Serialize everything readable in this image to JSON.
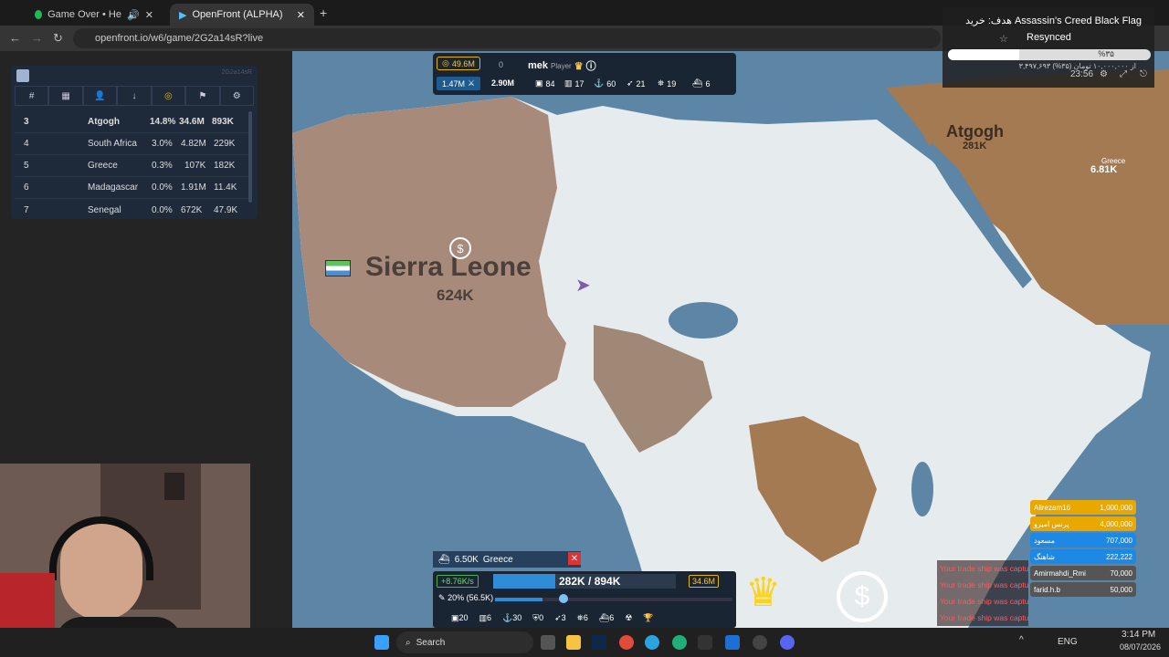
{
  "browser": {
    "tabs": [
      {
        "label": "Game Over • Helynt, Gameboy"
      },
      {
        "label": "OpenFront (ALPHA)"
      }
    ],
    "url": "openfront.io/w6/game/2G2a14sR?live",
    "new_tab": "+"
  },
  "leaderboard": {
    "game_id": "2G2a14sR",
    "rows": [
      {
        "rank": "3",
        "name": "Atgogh",
        "pct": "14.8%",
        "gold": "34.6M",
        "troops": "893K"
      },
      {
        "rank": "4",
        "name": "South Africa",
        "pct": "3.0%",
        "gold": "4.82M",
        "troops": "229K"
      },
      {
        "rank": "5",
        "name": "Greece",
        "pct": "0.3%",
        "gold": "107K",
        "troops": "182K"
      },
      {
        "rank": "6",
        "name": "Madagascar",
        "pct": "0.0%",
        "gold": "1.91M",
        "troops": "11.4K"
      },
      {
        "rank": "7",
        "name": "Senegal",
        "pct": "0.0%",
        "gold": "672K",
        "troops": "47.9K"
      }
    ],
    "header_rank": "#"
  },
  "player_bar": {
    "gold": "49.6M",
    "zero": "0",
    "name": "mek",
    "role": "Player",
    "troops": "1.47M",
    "workers": "2.90M",
    "stats": [
      "84",
      "17",
      "60",
      "21",
      "19",
      "6"
    ]
  },
  "map": {
    "country1": {
      "name": "Sierra Leone",
      "troops": "624K"
    },
    "country2": {
      "name": "Atgogh",
      "troops": "281K"
    },
    "country3": {
      "name": "Greece",
      "troops": "6.81K"
    }
  },
  "bottom": {
    "target_troops": "6.50K",
    "target_name": "Greece",
    "rate": "+8.76K/s",
    "population": "282K / 894K",
    "gold": "34.6M",
    "attack_ratio": "20% (56.5K)",
    "units": [
      "20",
      "6",
      "30",
      "0",
      "3",
      "6",
      "6"
    ]
  },
  "toasts": [
    "Your trade ship was captured",
    "Your trade ship was captured",
    "Your trade ship was captured",
    "Your trade ship was captured"
  ],
  "donors": [
    {
      "name": "Alirezam16",
      "amount": "1,000,000",
      "color": "#e8a800"
    },
    {
      "name": "پرنس امیرو",
      "amount": "4,000,000",
      "color": "#e8a800"
    },
    {
      "name": "مسعود",
      "amount": "707,000",
      "color": "#1e88e5"
    },
    {
      "name": "شاهنگ",
      "amount": "222,222",
      "color": "#1e88e5"
    },
    {
      "name": "Amirmahdi_Rmi",
      "amount": "70,000",
      "color": "#555"
    },
    {
      "name": "farid.h.b",
      "amount": "50,000",
      "color": "#555"
    }
  ],
  "overlay": {
    "goal": "هدف: خرید Assassin's Creed Black Flag",
    "status": "Resynced",
    "percent": "%۳۵",
    "progress": 0.35,
    "sub": "۳,۴۹۷,۶۹۳ از ۱۰,۰۰۰,۰۰۰ تومان (۳۵%)",
    "time": "23:56"
  },
  "taskbar": {
    "search": "Search",
    "lang": "ENG",
    "time": "3:14 PM",
    "date": "08/07/2026"
  }
}
